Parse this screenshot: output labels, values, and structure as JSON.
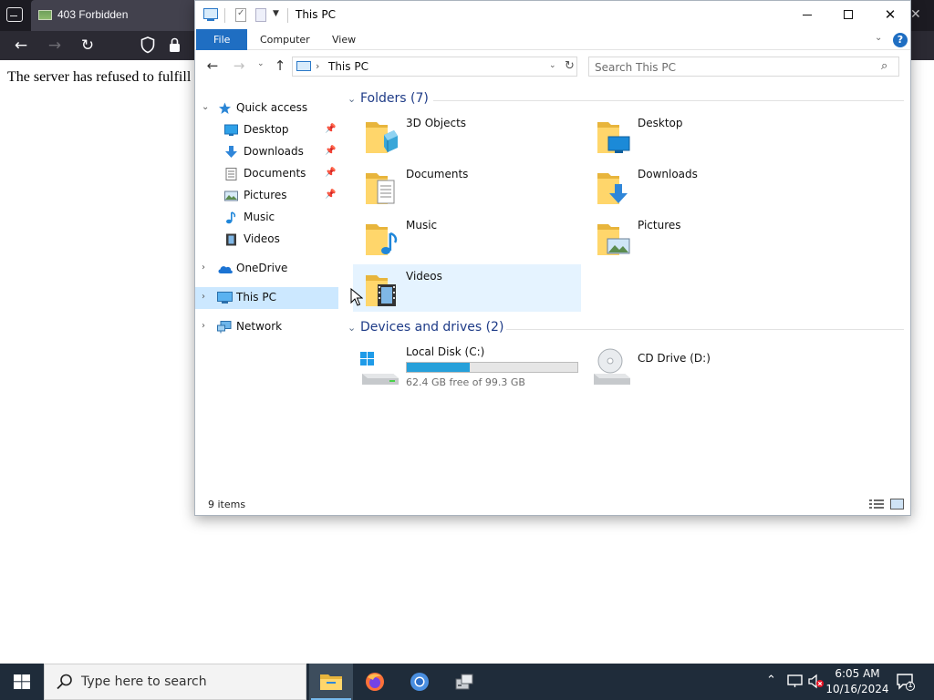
{
  "browser": {
    "tab_title": "403 Forbidden",
    "page_text": "The server has refused to fulfill"
  },
  "explorer": {
    "title": "This PC",
    "ribbon_tabs": [
      "File",
      "Computer",
      "View"
    ],
    "help_label": "?",
    "address_path": "This PC",
    "search_placeholder": "Search This PC",
    "nav_pane": {
      "quick_access": "Quick access",
      "quick_items": [
        "Desktop",
        "Downloads",
        "Documents",
        "Pictures",
        "Music",
        "Videos"
      ],
      "onedrive": "OneDrive",
      "this_pc": "This PC",
      "network": "Network"
    },
    "folders_header": "Folders (7)",
    "folders": [
      "3D Objects",
      "Desktop",
      "Documents",
      "Downloads",
      "Music",
      "Pictures",
      "Videos"
    ],
    "drives_header": "Devices and drives (2)",
    "drives": [
      {
        "name": "Local Disk (C:)",
        "free_text": "62.4 GB free of 99.3 GB",
        "used_fraction": 0.37
      },
      {
        "name": "CD Drive (D:)"
      }
    ],
    "status": "9 items"
  },
  "taskbar": {
    "search_text": "Type here to search",
    "time": "6:05 AM",
    "date": "10/16/2024",
    "notification_count": "1"
  },
  "colors": {
    "accent": "#1f6ec2",
    "selection": "#cce8ff",
    "hover": "#e5f3ff",
    "drive_bar": "#26a0da",
    "taskbar": "#1f2c3a"
  }
}
